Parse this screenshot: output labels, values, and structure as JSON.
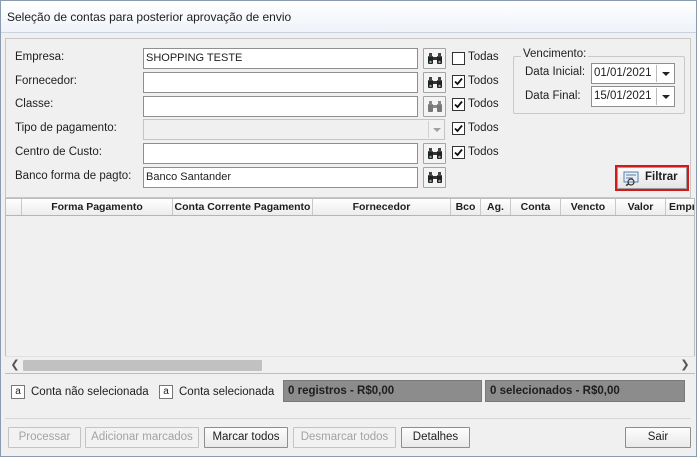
{
  "window": {
    "title": "Seleção de contas para posterior aprovação de envio"
  },
  "filters": {
    "empresa": {
      "label": "Empresa:",
      "value": "SHOPPING TESTE",
      "todos_label": "Todas",
      "todos_checked": false
    },
    "fornecedor": {
      "label": "Fornecedor:",
      "value": "",
      "todos_label": "Todos",
      "todos_checked": true
    },
    "classe": {
      "label": "Classe:",
      "value": "",
      "todos_label": "Todos",
      "todos_checked": true
    },
    "tipo_pagamento": {
      "label": "Tipo de pagamento:",
      "value": "",
      "todos_label": "Todos",
      "todos_checked": true
    },
    "centro_custo": {
      "label": "Centro de Custo:",
      "value": "",
      "todos_label": "Todos",
      "todos_checked": true
    },
    "banco_forma": {
      "label": "Banco forma de pagto:",
      "value": "Banco Santander"
    }
  },
  "vencimento": {
    "title": "Vencimento:",
    "data_inicial_label": "Data Inicial:",
    "data_inicial": "01/01/2021",
    "data_final_label": "Data Final:",
    "data_final": "15/01/2021"
  },
  "filtrar_label": "Filtrar",
  "grid": {
    "columns": [
      "Forma Pagamento",
      "Conta Corrente Pagamento",
      "Fornecedor",
      "Bco",
      "Ag.",
      "Conta",
      "Vencto",
      "Valor",
      "Empr"
    ]
  },
  "legend": {
    "box_letter": "a",
    "nao_selecionada": "Conta não selecionada",
    "selecionada": "Conta selecionada"
  },
  "status": {
    "registros": "0 registros - R$0,00",
    "selecionados": "0 selecionados - R$0,00"
  },
  "buttons": {
    "processar": "Processar",
    "adicionar": "Adicionar marcados",
    "marcar": "Marcar todos",
    "desmarcar": "Desmarcar todos",
    "detalhes": "Detalhes",
    "sair": "Sair"
  },
  "icons": {
    "binoculars": "binoculars-icon",
    "checkmark": "checkmark-icon",
    "filter": "filter-icon"
  }
}
